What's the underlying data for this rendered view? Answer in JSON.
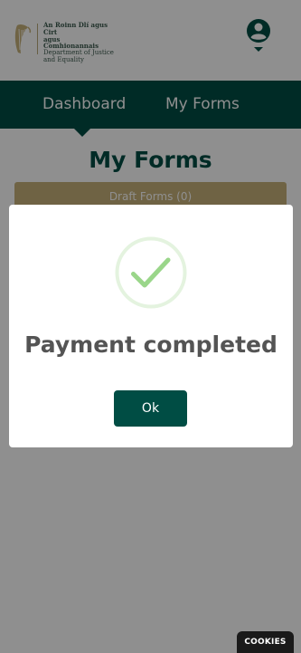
{
  "header": {
    "logo_line1": "An Roinn Dlí agus Cirt",
    "logo_line2": "agus Comhionannais",
    "logo_line3": "Department of Justice",
    "logo_line4": "and Equality",
    "user_icon": "user-avatar-icon",
    "dropdown_icon": "caret-down-icon"
  },
  "nav": {
    "items": [
      {
        "label": "Dashboard"
      },
      {
        "label": "My Forms"
      }
    ]
  },
  "main": {
    "title": "My Forms",
    "draft_tab_label": "Draft Forms (0)"
  },
  "modal": {
    "icon": "check-circle-icon",
    "title": "Payment completed",
    "ok_label": "Ok"
  },
  "cookies": {
    "label": "COOKIES"
  },
  "colors": {
    "brand_green": "#004d44",
    "gold": "#c7b179",
    "check_green": "#9ad68a"
  }
}
